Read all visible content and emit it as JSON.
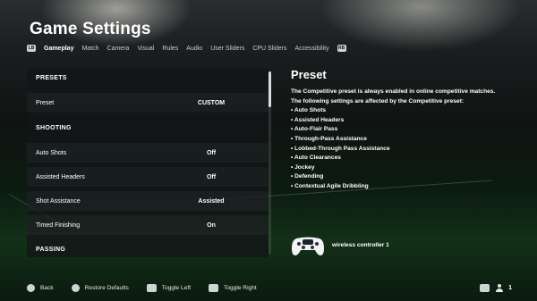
{
  "screen": {
    "title": "Game Settings"
  },
  "tabs": {
    "left_bumper": "LB",
    "right_bumper": "RB",
    "items": [
      "Gameplay",
      "Match",
      "Camera",
      "Visual",
      "Rules",
      "Audio",
      "User Sliders",
      "CPU Sliders",
      "Accessibility"
    ],
    "active": "Gameplay"
  },
  "settings": {
    "rows": [
      {
        "type": "header",
        "label": "PRESETS",
        "value": ""
      },
      {
        "type": "setting",
        "label": "Preset",
        "value": "CUSTOM"
      },
      {
        "type": "header",
        "label": "SHOOTING",
        "value": ""
      },
      {
        "type": "setting",
        "label": "Auto Shots",
        "value": "Off"
      },
      {
        "type": "setting",
        "label": "Assisted Headers",
        "value": "Off"
      },
      {
        "type": "setting",
        "label": "Shot Assistance",
        "value": "Assisted"
      },
      {
        "type": "setting",
        "label": "Timed Finishing",
        "value": "On"
      },
      {
        "type": "header",
        "label": "PASSING",
        "value": ""
      }
    ]
  },
  "detail": {
    "title": "Preset",
    "line1": "The Competitive preset is always enabled in online competitive matches.",
    "line2": "The following settings are affected by the Competitive preset:",
    "bullets": [
      "• Auto Shots",
      "• Assisted Headers",
      "• Auto-Flair Pass",
      "• Through-Pass Assistance",
      "• Lobbed-Through Pass Assistance",
      "• Auto Clearances",
      "• Jockey",
      "• Defending",
      "• Contextual Agile Dribbling"
    ]
  },
  "controller": {
    "label": "wireless controller 1"
  },
  "footer": {
    "back": "Back",
    "restore": "Restore Defaults",
    "toggle_left": "Toggle Left",
    "toggle_right": "Toggle Right",
    "player_count": "1"
  },
  "colors": {
    "panel": "#121618",
    "accent_text": "#ffffff",
    "chip": "#cfd3d6"
  }
}
